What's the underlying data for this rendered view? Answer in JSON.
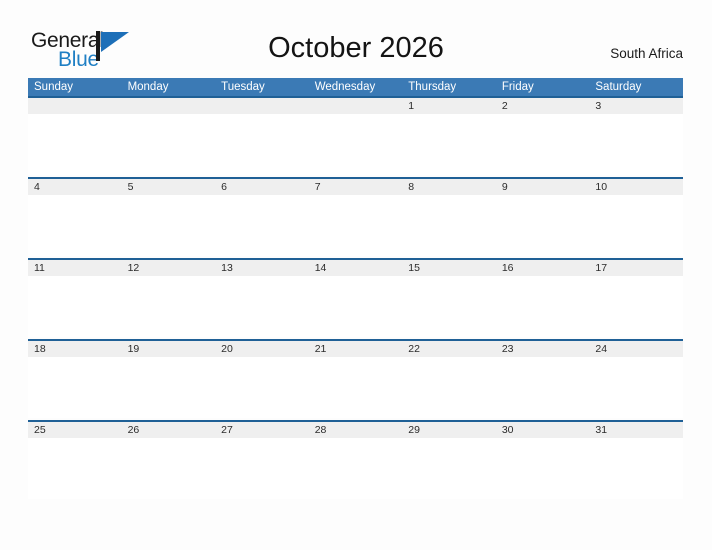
{
  "brand": {
    "word_one": "General",
    "word_two": "Blue",
    "flag_color": "#1f7fc4",
    "text_color": "#1a1a1a"
  },
  "header": {
    "title": "October 2026",
    "region": "South Africa"
  },
  "theme": {
    "header_blue": "#3b7ab5",
    "rule_blue": "#1f6096",
    "date_band_gray": "#efefef",
    "page_background": "#fdfdfd"
  },
  "calendar": {
    "month": "October",
    "year": "2026",
    "weekday_headers": [
      "Sunday",
      "Monday",
      "Tuesday",
      "Wednesday",
      "Thursday",
      "Friday",
      "Saturday"
    ],
    "weeks": [
      [
        "",
        "",
        "",
        "",
        "1",
        "2",
        "3"
      ],
      [
        "4",
        "5",
        "6",
        "7",
        "8",
        "9",
        "10"
      ],
      [
        "11",
        "12",
        "13",
        "14",
        "15",
        "16",
        "17"
      ],
      [
        "18",
        "19",
        "20",
        "21",
        "22",
        "23",
        "24"
      ],
      [
        "25",
        "26",
        "27",
        "28",
        "29",
        "30",
        "31"
      ]
    ]
  }
}
